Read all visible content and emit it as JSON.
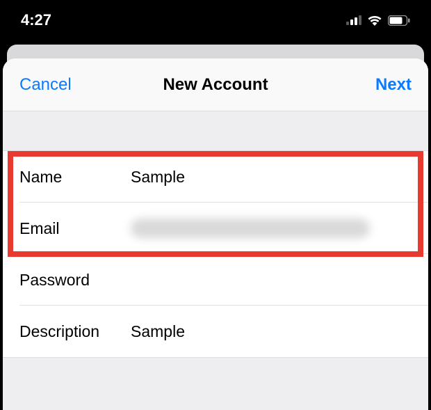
{
  "statusBar": {
    "time": "4:27"
  },
  "nav": {
    "cancel": "Cancel",
    "title": "New Account",
    "next": "Next"
  },
  "fields": {
    "name": {
      "label": "Name",
      "value": "Sample"
    },
    "email": {
      "label": "Email",
      "value": ""
    },
    "password": {
      "label": "Password",
      "value": ""
    },
    "description": {
      "label": "Description",
      "value": "Sample"
    }
  }
}
